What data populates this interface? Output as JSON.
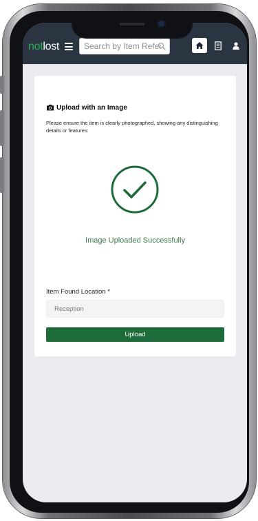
{
  "brand": {
    "part1": "not",
    "part2": "lost"
  },
  "navbar": {
    "search_placeholder": "Search by Item Reference",
    "icons": {
      "menu": "hamburger-menu-icon",
      "search": "search-icon",
      "home": "home-icon",
      "receipt": "receipt-icon",
      "user": "user-icon"
    }
  },
  "upload_card": {
    "title": "Upload with an Image",
    "description": "Please ensure the item is clearly photographed, showing any distinguishing details or features:",
    "status_message": "Image Uploaded Successfully",
    "location_label": "Item Found Location *",
    "location_value": "Reception",
    "upload_button_label": "Upload"
  },
  "colors": {
    "navbar_bg": "#2b3541",
    "brand_green": "#2fae56",
    "success_green": "#3b7a4b",
    "button_green": "#1d6b38",
    "page_bg": "#e9ebef"
  }
}
